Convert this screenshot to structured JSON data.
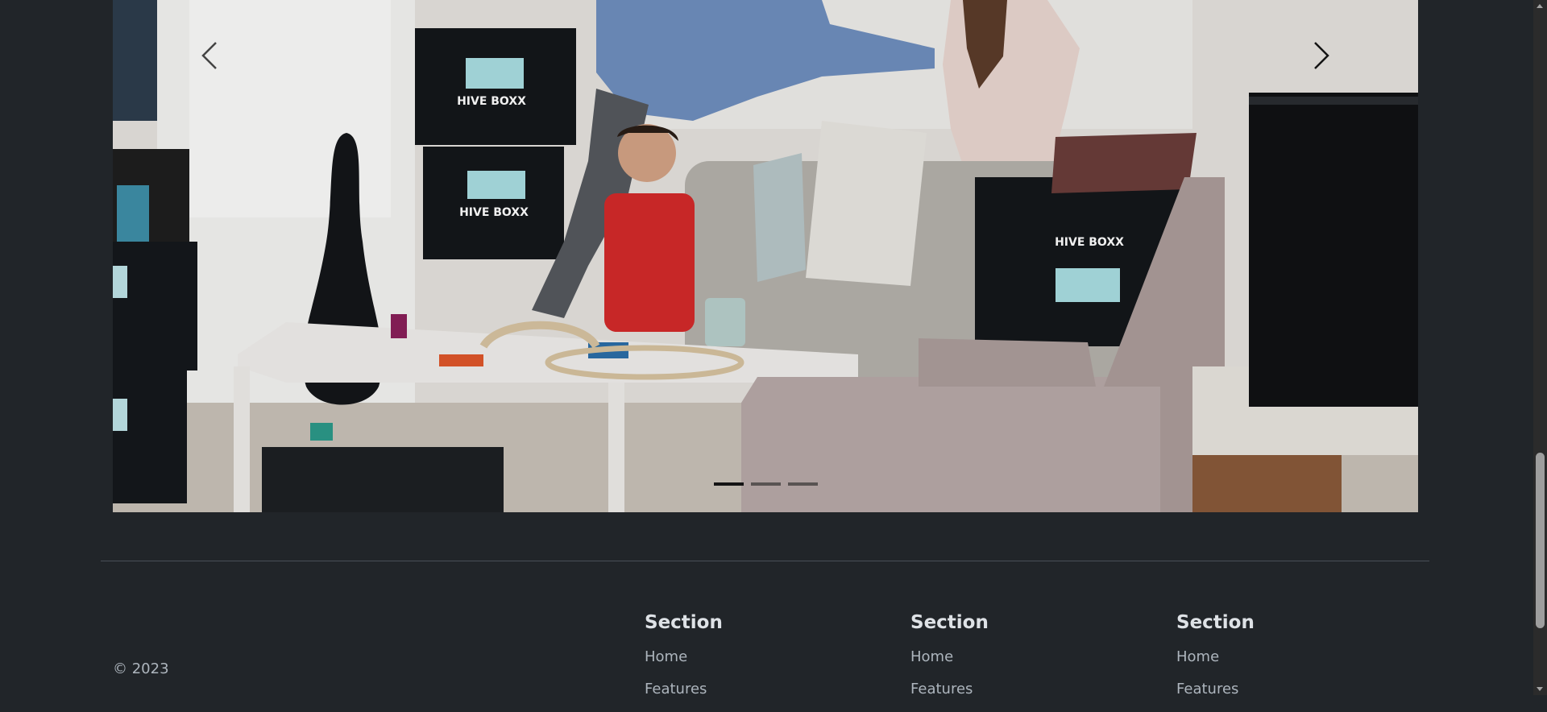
{
  "carousel": {
    "prev_icon": "chevron-left-icon",
    "next_icon": "chevron-right-icon",
    "indicators": [
      {
        "active": true
      },
      {
        "active": false
      },
      {
        "active": false
      }
    ]
  },
  "footer": {
    "copyright": "© 2023",
    "sections": [
      {
        "title": "Section",
        "links": [
          "Home",
          "Features"
        ]
      },
      {
        "title": "Section",
        "links": [
          "Home",
          "Features"
        ]
      },
      {
        "title": "Section",
        "links": [
          "Home",
          "Features"
        ]
      }
    ]
  },
  "photo_text": {
    "box_brand": "HIVE BOXX"
  },
  "colors": {
    "background": "#212529",
    "text": "#dee2e6",
    "muted_text": "#adb5bd"
  }
}
